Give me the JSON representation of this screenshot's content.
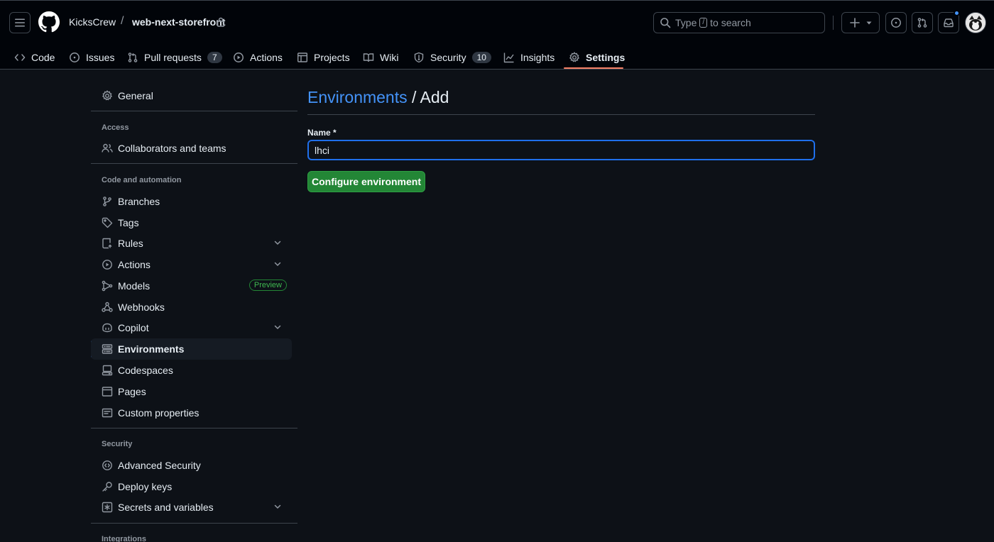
{
  "header": {
    "owner": "KicksCrew",
    "separator": "/",
    "repo": "web-next-storefront",
    "search_prefix": "Type",
    "search_key": "/",
    "search_suffix": "to search"
  },
  "repo_nav": {
    "tabs": [
      {
        "label": "Code",
        "icon": "code-icon"
      },
      {
        "label": "Issues",
        "icon": "issue-opened-icon"
      },
      {
        "label": "Pull requests",
        "icon": "git-pull-request-icon",
        "count": "7"
      },
      {
        "label": "Actions",
        "icon": "play-icon"
      },
      {
        "label": "Projects",
        "icon": "table-icon"
      },
      {
        "label": "Wiki",
        "icon": "book-icon"
      },
      {
        "label": "Security",
        "icon": "shield-icon",
        "count": "10"
      },
      {
        "label": "Insights",
        "icon": "graph-icon"
      },
      {
        "label": "Settings",
        "icon": "gear-icon",
        "selected": true
      }
    ]
  },
  "sidebar": {
    "general": "General",
    "access_heading": "Access",
    "collaborators": "Collaborators and teams",
    "code_heading": "Code and automation",
    "items": [
      {
        "label": "Branches",
        "icon": "git-branch-icon"
      },
      {
        "label": "Tags",
        "icon": "tag-icon"
      },
      {
        "label": "Rules",
        "icon": "repo-push-icon",
        "expandable": true
      },
      {
        "label": "Actions",
        "icon": "play-icon",
        "expandable": true
      },
      {
        "label": "Models",
        "icon": "workflow-icon",
        "badge": "Preview"
      },
      {
        "label": "Webhooks",
        "icon": "webhook-icon"
      },
      {
        "label": "Copilot",
        "icon": "copilot-icon",
        "expandable": true
      },
      {
        "label": "Environments",
        "icon": "server-icon",
        "active": true
      },
      {
        "label": "Codespaces",
        "icon": "codespaces-icon"
      },
      {
        "label": "Pages",
        "icon": "browser-icon"
      },
      {
        "label": "Custom properties",
        "icon": "note-icon"
      }
    ],
    "security_heading": "Security",
    "security_items": [
      {
        "label": "Advanced Security",
        "icon": "codescan-icon"
      },
      {
        "label": "Deploy keys",
        "icon": "key-icon"
      },
      {
        "label": "Secrets and variables",
        "icon": "key-asterisk-icon",
        "expandable": true
      }
    ],
    "integrations_heading": "Integrations"
  },
  "main": {
    "breadcrumb_link": "Environments",
    "breadcrumb_rest": " / Add",
    "name_label": "Name *",
    "name_value": "lhci",
    "submit_label": "Configure environment"
  },
  "colors": {
    "background": "#0d1117",
    "header_bg": "#010409",
    "accent_blue": "#4493f8",
    "primary_green": "#238636",
    "tab_underline": "#f78166"
  }
}
